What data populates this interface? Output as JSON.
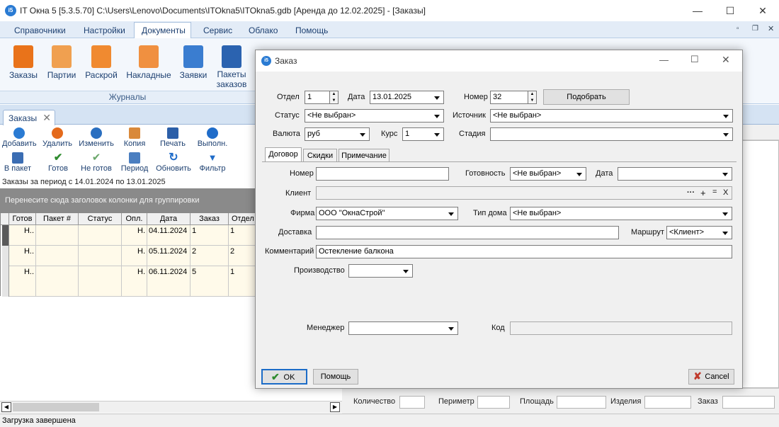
{
  "app": {
    "title": "IT Окна 5 [5.3.5.70] C:\\Users\\Lenovo\\Documents\\ITOkna5\\ITOkna5.gdb [Аренда до 12.02.2025] - [Заказы]",
    "icon_text": "i5"
  },
  "menu": [
    "Справочники",
    "Настройки",
    "Документы",
    "Сервис",
    "Облако",
    "Помощь"
  ],
  "ribbon": {
    "buttons": [
      "Заказы",
      "Партии",
      "Раскрой",
      "Накладные",
      "Заявки",
      "Пакеты заказов"
    ],
    "group_label": "Журналы"
  },
  "doc_tab": "Заказы",
  "toolbar": {
    "row1": [
      "Добавить",
      "Удалить",
      "Изменить",
      "Копия",
      "Печать",
      "Выполн."
    ],
    "row2": [
      "В пакет",
      "Готов",
      "Не готов",
      "Период",
      "Обновить",
      "Фильтр"
    ]
  },
  "period_text": "Заказы за период с 14.01.2024 по 13.01.2025",
  "group_hint": "Перенесите сюда заголовок колонки для группировки",
  "grid": {
    "columns": [
      "Готов",
      "Пакет #",
      "Статус",
      "Опл.",
      "Дата",
      "Заказ",
      "Отдел"
    ],
    "rows": [
      [
        "Н..",
        "",
        "",
        "Н.",
        "04.11.2024",
        "1",
        "1"
      ],
      [
        "Н..",
        "",
        "",
        "Н.",
        "05.11.2024",
        "2",
        "2"
      ],
      [
        "Н..",
        "",
        "",
        "Н.",
        "06.11.2024",
        "5",
        "1"
      ]
    ]
  },
  "footer": [
    "Количество",
    "Периметр",
    "Площадь",
    "Изделия",
    "Заказ"
  ],
  "status": "Загрузка завершена",
  "dialog": {
    "title": "Заказ",
    "otdel_label": "Отдел",
    "otdel_value": "1",
    "data_label": "Дата",
    "data_value": "13.01.2025",
    "nomer_label": "Номер",
    "nomer_value": "32",
    "podobrat": "Подобрать",
    "status_label": "Статус",
    "status_value": "<Не выбран>",
    "istochnik_label": "Источник",
    "istochnik_value": "<Не выбран>",
    "valuta_label": "Валюта",
    "valuta_value": "руб",
    "kurs_label": "Курс",
    "kurs_value": "1",
    "stadiya_label": "Стадия",
    "stadiya_value": "",
    "tabs": [
      "Договор",
      "Скидки",
      "Примечание"
    ],
    "dog_nomer_label": "Номер",
    "dog_nomer_value": "",
    "gotovnost_label": "Готовность",
    "gotovnost_value": "<Не выбран>",
    "dog_data_label": "Дата",
    "dog_data_value": "",
    "klient_label": "Клиент",
    "klient_value": "",
    "klient_btns": [
      "···",
      "+",
      "=",
      "X"
    ],
    "firma_label": "Фирма",
    "firma_value": "ООО \"ОкнаСтрой\"",
    "tip_doma_label": "Тип дома",
    "tip_doma_value": "<Не выбран>",
    "dostavka_label": "Доставка",
    "dostavka_value": "",
    "marshrut_label": "Маршрут",
    "marshrut_value": "<Клиент>",
    "komment_label": "Комментарий",
    "komment_value": "Остекление балкона",
    "proizv_label": "Производство",
    "proizv_value": "",
    "menedzher_label": "Менеджер",
    "menedzher_value": "",
    "kod_label": "Код",
    "kod_value": "",
    "ok": "OK",
    "help": "Помощь",
    "cancel": "Cancel"
  },
  "colors": {
    "accent": "#2a7bd3",
    "grid_row": "#fffaea",
    "ok_check": "#2e8b2e",
    "cancel_x": "#c0392b"
  }
}
